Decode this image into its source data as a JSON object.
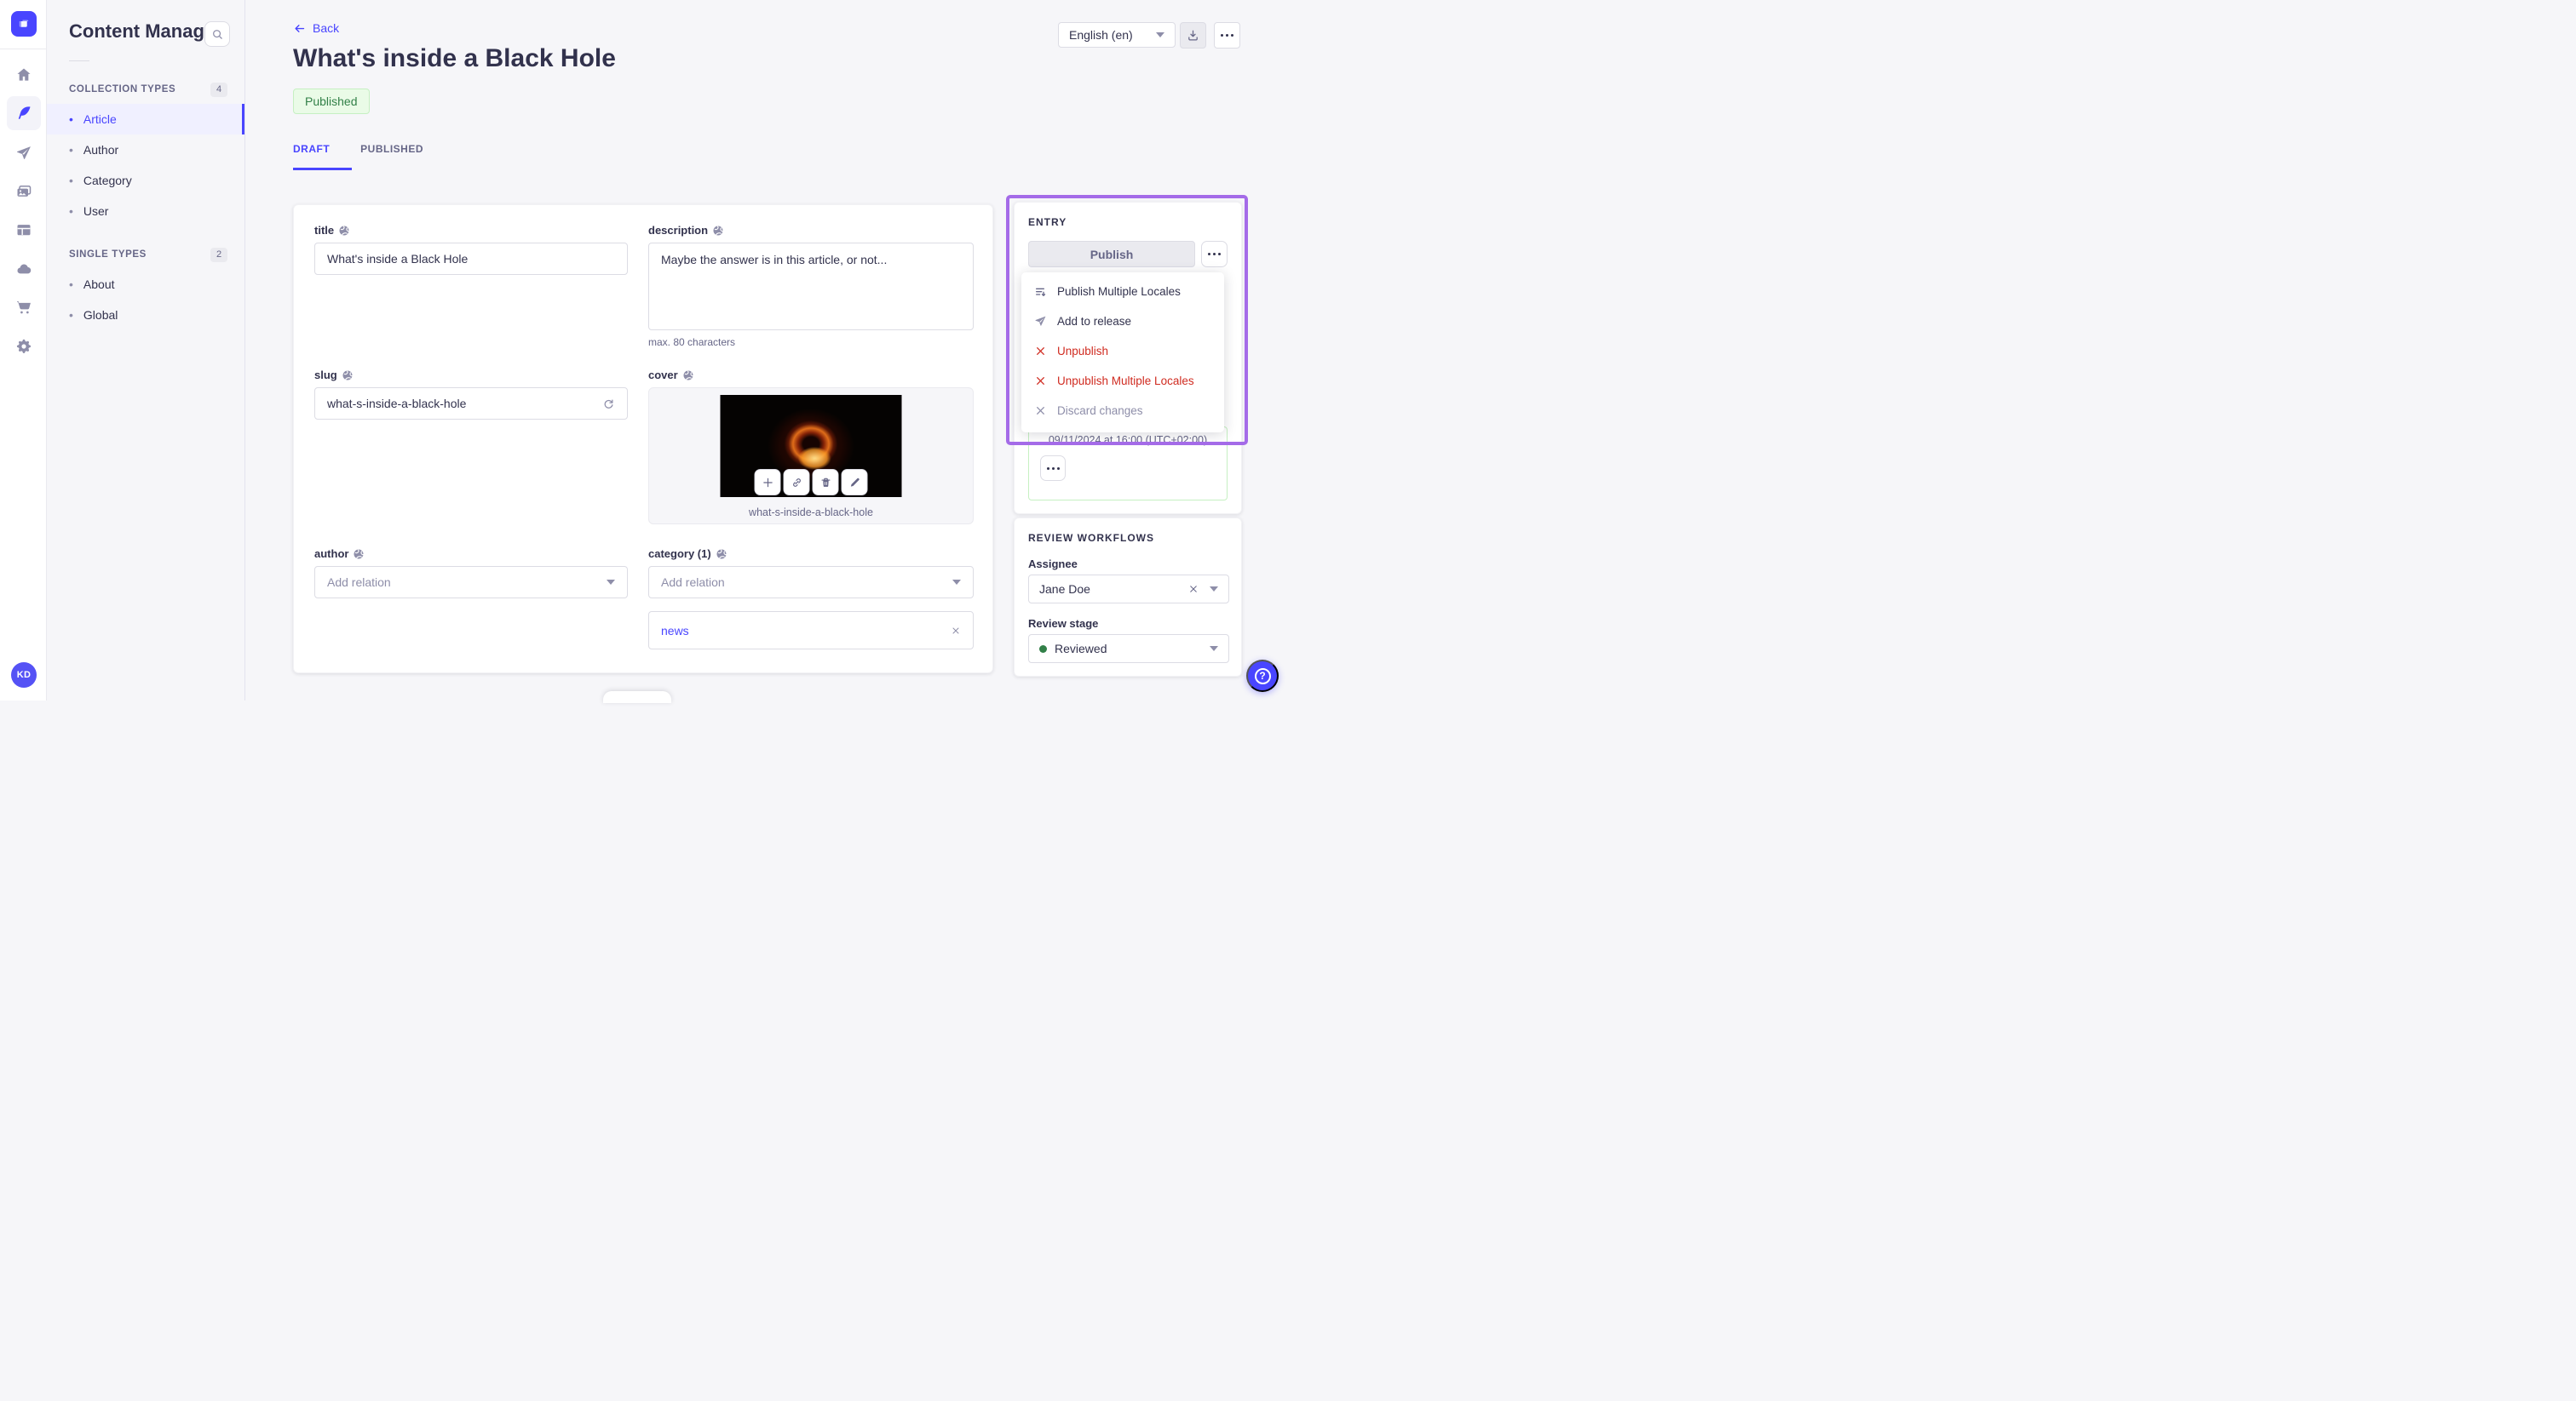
{
  "app": {
    "user_initials": "KD"
  },
  "nav_rail": {
    "icons": [
      "strapi-logo",
      "home",
      "content-manager",
      "releases",
      "media-library",
      "content-type-builder",
      "deploy",
      "purchases",
      "settings"
    ]
  },
  "sidebar": {
    "title": "Content Manager",
    "sections": [
      {
        "label": "COLLECTION TYPES",
        "count": "4",
        "items": [
          {
            "label": "Article"
          },
          {
            "label": "Author"
          },
          {
            "label": "Category"
          },
          {
            "label": "User"
          }
        ]
      },
      {
        "label": "SINGLE TYPES",
        "count": "2",
        "items": [
          {
            "label": "About"
          },
          {
            "label": "Global"
          }
        ]
      }
    ]
  },
  "header": {
    "back_label": "Back",
    "title": "What's inside a Black Hole",
    "status_badge": "Published",
    "tabs": [
      {
        "label": "DRAFT"
      },
      {
        "label": "PUBLISHED"
      }
    ],
    "locale_selector": "English (en)"
  },
  "form": {
    "title": {
      "label": "title",
      "value": "What's inside a Black Hole"
    },
    "description": {
      "label": "description",
      "value": "Maybe the answer is in this article, or not...",
      "helper": "max. 80 characters"
    },
    "slug": {
      "label": "slug",
      "value": "what-s-inside-a-black-hole"
    },
    "cover": {
      "label": "cover",
      "caption": "what-s-inside-a-black-hole"
    },
    "author": {
      "label": "author",
      "placeholder": "Add relation"
    },
    "category": {
      "label": "category (1)",
      "placeholder": "Add relation",
      "tag": "news"
    }
  },
  "entry_panel": {
    "title": "ENTRY",
    "publish_label": "Publish",
    "schedule_date": "09/11/2024 at 16:00 (UTC+02:00)",
    "menu_items": [
      {
        "label": "Publish Multiple Locales"
      },
      {
        "label": "Add to release"
      },
      {
        "label": "Unpublish"
      },
      {
        "label": "Unpublish Multiple Locales"
      },
      {
        "label": "Discard changes"
      }
    ]
  },
  "review_panel": {
    "title": "REVIEW WORKFLOWS",
    "assignee_label": "Assignee",
    "assignee_value": "Jane Doe",
    "stage_label": "Review stage",
    "stage_value": "Reviewed"
  },
  "colors": {
    "primary": "#4945ff",
    "annotation": "#a46be8",
    "success": "#328048",
    "danger": "#d02b20"
  }
}
